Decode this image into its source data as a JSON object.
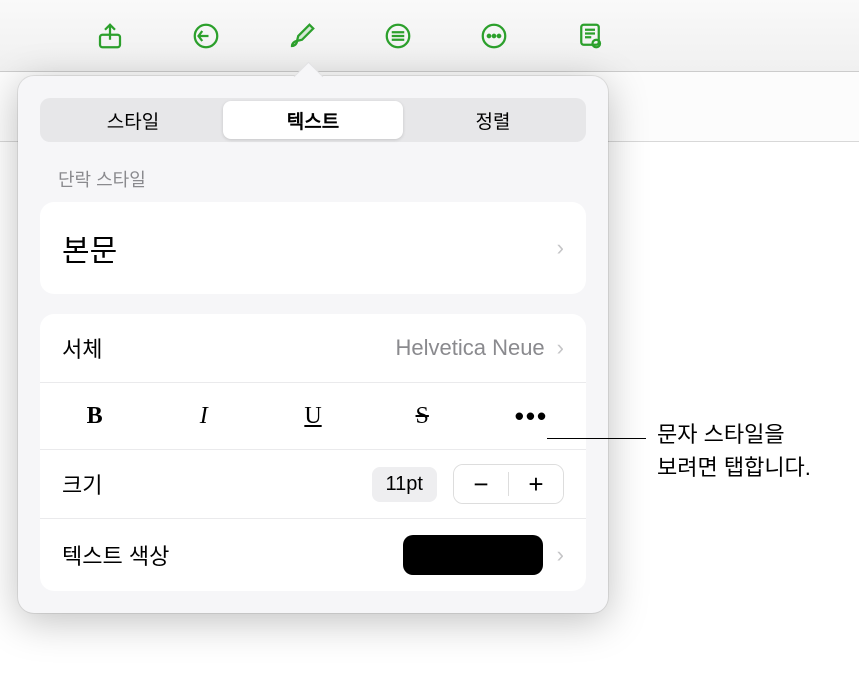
{
  "toolbar": {
    "icons": [
      "share",
      "undo",
      "brush",
      "list",
      "more-circle",
      "document-view"
    ]
  },
  "tabs": {
    "items": [
      "스타일",
      "텍스트",
      "정렬"
    ],
    "active_index": 1
  },
  "paragraph_style": {
    "section_label": "단락 스타일",
    "value": "본문"
  },
  "font": {
    "label": "서체",
    "value": "Helvetica Neue"
  },
  "text_styles": {
    "bold": "B",
    "italic": "I",
    "underline": "U",
    "strike": "S",
    "more": "•••"
  },
  "size": {
    "label": "크기",
    "value": "11pt",
    "minus": "−",
    "plus": "+"
  },
  "text_color": {
    "label": "텍스트 색상",
    "value": "#000000"
  },
  "callout": {
    "line1": "문자 스타일을",
    "line2": "보려면 탭합니다."
  }
}
